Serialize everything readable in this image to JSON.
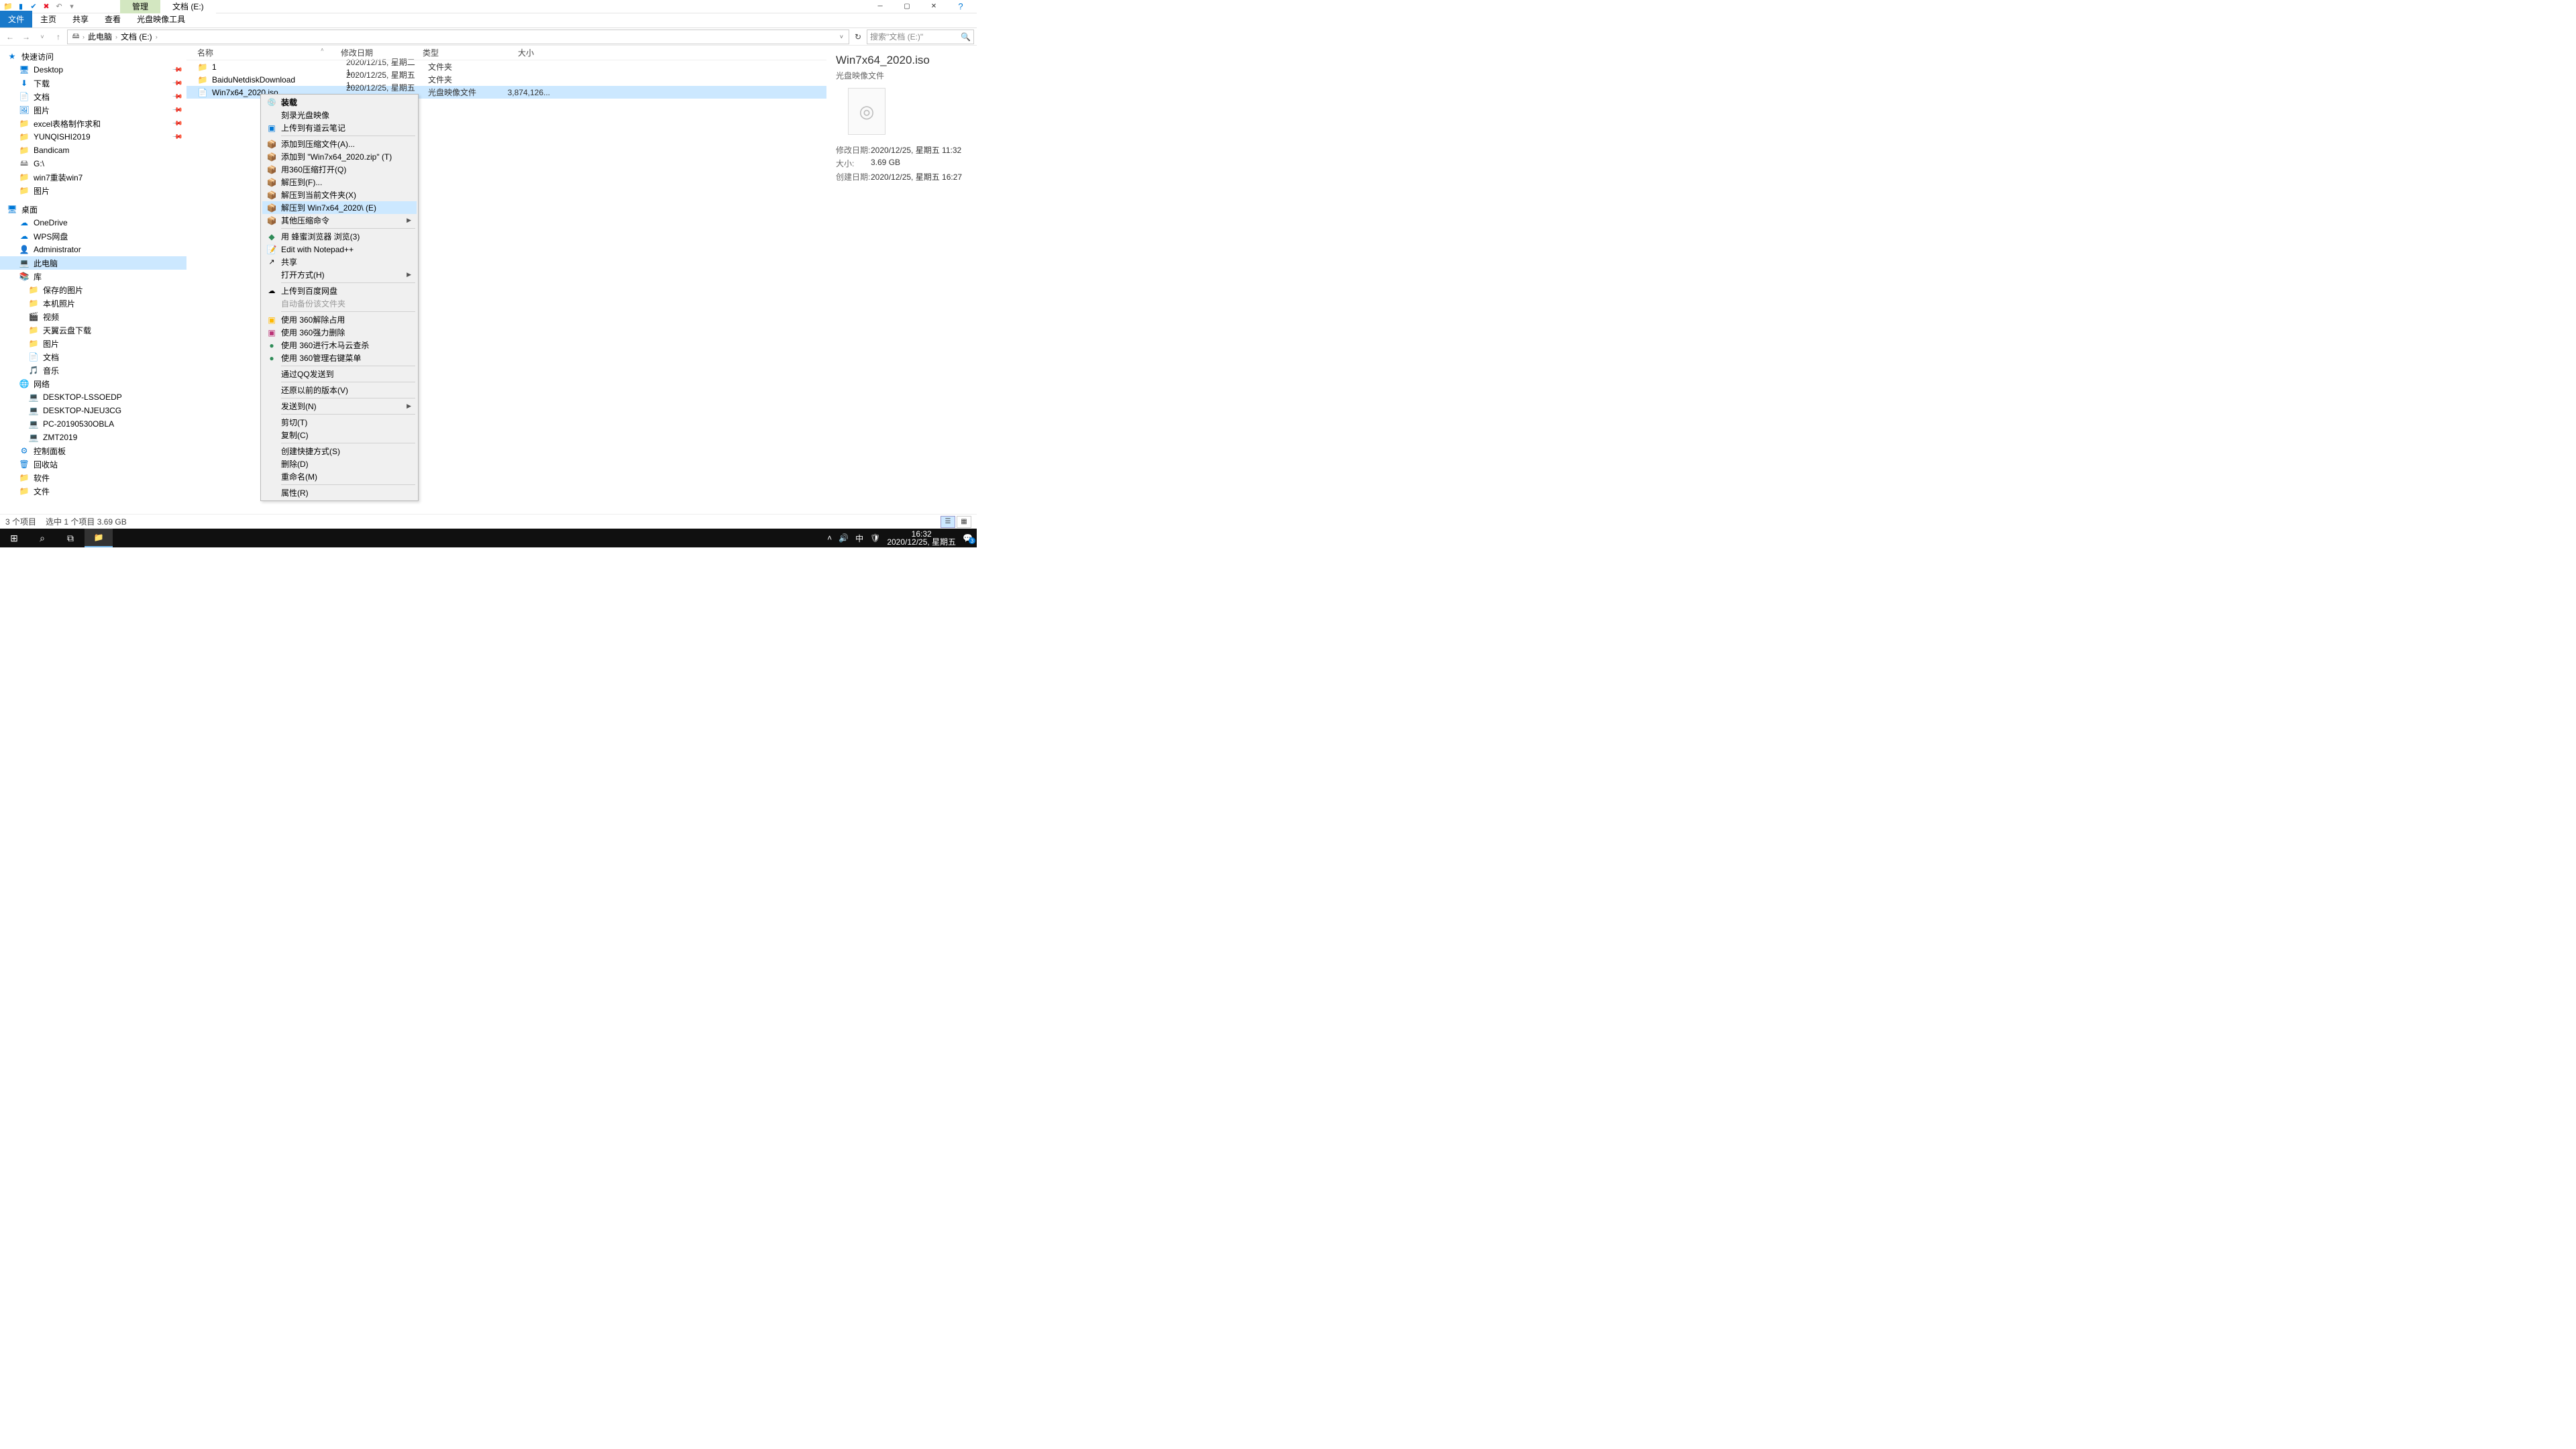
{
  "window": {
    "context_tab": "管理",
    "location_tab": "文档 (E:)"
  },
  "ribbon": {
    "file": "文件",
    "home": "主页",
    "share": "共享",
    "view": "查看",
    "tool": "光盘映像工具"
  },
  "address": {
    "crumbs": [
      "此电脑",
      "文档 (E:)"
    ],
    "search_placeholder": "搜索\"文档 (E:)\""
  },
  "nav": {
    "quick": "快速访问",
    "items_quick": [
      "Desktop",
      "下载",
      "文档",
      "图片",
      "excel表格制作求和",
      "YUNQISHI2019",
      "Bandicam",
      "G:\\",
      "win7重装win7",
      "图片"
    ],
    "desktop": "桌面",
    "items_desktop": [
      "OneDrive",
      "WPS网盘",
      "Administrator",
      "此电脑",
      "库",
      "保存的图片",
      "本机照片",
      "视频",
      "天翼云盘下载",
      "图片",
      "文档",
      "音乐",
      "网络",
      "DESKTOP-LSSOEDP",
      "DESKTOP-NJEU3CG",
      "PC-20190530OBLA",
      "ZMT2019",
      "控制面板",
      "回收站",
      "软件",
      "文件"
    ]
  },
  "columns": {
    "name": "名称",
    "date": "修改日期",
    "type": "类型",
    "size": "大小"
  },
  "files": [
    {
      "name": "1",
      "date": "2020/12/15, 星期二 1...",
      "type": "文件夹",
      "size": ""
    },
    {
      "name": "BaiduNetdiskDownload",
      "date": "2020/12/25, 星期五 1...",
      "type": "文件夹",
      "size": ""
    },
    {
      "name": "Win7x64_2020.iso",
      "date": "2020/12/25, 星期五 1...",
      "type": "光盘映像文件",
      "size": "3,874,126..."
    }
  ],
  "context_menu": [
    {
      "label": "装载",
      "bold": true,
      "ico": "disc"
    },
    {
      "label": "刻录光盘映像"
    },
    {
      "label": "上传到有道云笔记",
      "ico": "blue"
    },
    {
      "sep": true
    },
    {
      "label": "添加到压缩文件(A)...",
      "ico": "zip"
    },
    {
      "label": "添加到 \"Win7x64_2020.zip\" (T)",
      "ico": "zip"
    },
    {
      "label": "用360压缩打开(Q)",
      "ico": "zip"
    },
    {
      "label": "解压到(F)...",
      "ico": "zip"
    },
    {
      "label": "解压到当前文件夹(X)",
      "ico": "zip"
    },
    {
      "label": "解压到 Win7x64_2020\\ (E)",
      "ico": "zip",
      "hover": true
    },
    {
      "label": "其他压缩命令",
      "ico": "zip",
      "arrow": true
    },
    {
      "sep": true
    },
    {
      "label": "用 蜂蜜浏览器 浏览(3)",
      "ico": "green"
    },
    {
      "label": "Edit with Notepad++",
      "ico": "npp"
    },
    {
      "label": "共享",
      "ico": "share"
    },
    {
      "label": "打开方式(H)",
      "arrow": true
    },
    {
      "sep": true
    },
    {
      "label": "上传到百度网盘",
      "ico": "cloud"
    },
    {
      "label": "自动备份该文件夹",
      "disabled": true
    },
    {
      "sep": true
    },
    {
      "label": "使用 360解除占用",
      "ico": "360"
    },
    {
      "label": "使用 360强力删除",
      "ico": "360d"
    },
    {
      "label": "使用 360进行木马云查杀",
      "ico": "360y"
    },
    {
      "label": "使用 360管理右键菜单",
      "ico": "360y"
    },
    {
      "sep": true
    },
    {
      "label": "通过QQ发送到"
    },
    {
      "sep": true
    },
    {
      "label": "还原以前的版本(V)"
    },
    {
      "sep": true
    },
    {
      "label": "发送到(N)",
      "arrow": true
    },
    {
      "sep": true
    },
    {
      "label": "剪切(T)"
    },
    {
      "label": "复制(C)"
    },
    {
      "sep": true
    },
    {
      "label": "创建快捷方式(S)"
    },
    {
      "label": "删除(D)"
    },
    {
      "label": "重命名(M)"
    },
    {
      "sep": true
    },
    {
      "label": "属性(R)"
    }
  ],
  "details": {
    "title": "Win7x64_2020.iso",
    "subtitle": "光盘映像文件",
    "rows": [
      {
        "label": "修改日期:",
        "value": "2020/12/25, 星期五 11:32"
      },
      {
        "label": "大小:",
        "value": "3.69 GB"
      },
      {
        "label": "创建日期:",
        "value": "2020/12/25, 星期五 16:27"
      }
    ]
  },
  "status": {
    "count": "3 个项目",
    "selection": "选中 1 个项目  3.69 GB"
  },
  "taskbar": {
    "time": "16:32",
    "date": "2020/12/25, 星期五",
    "ime": "中"
  }
}
